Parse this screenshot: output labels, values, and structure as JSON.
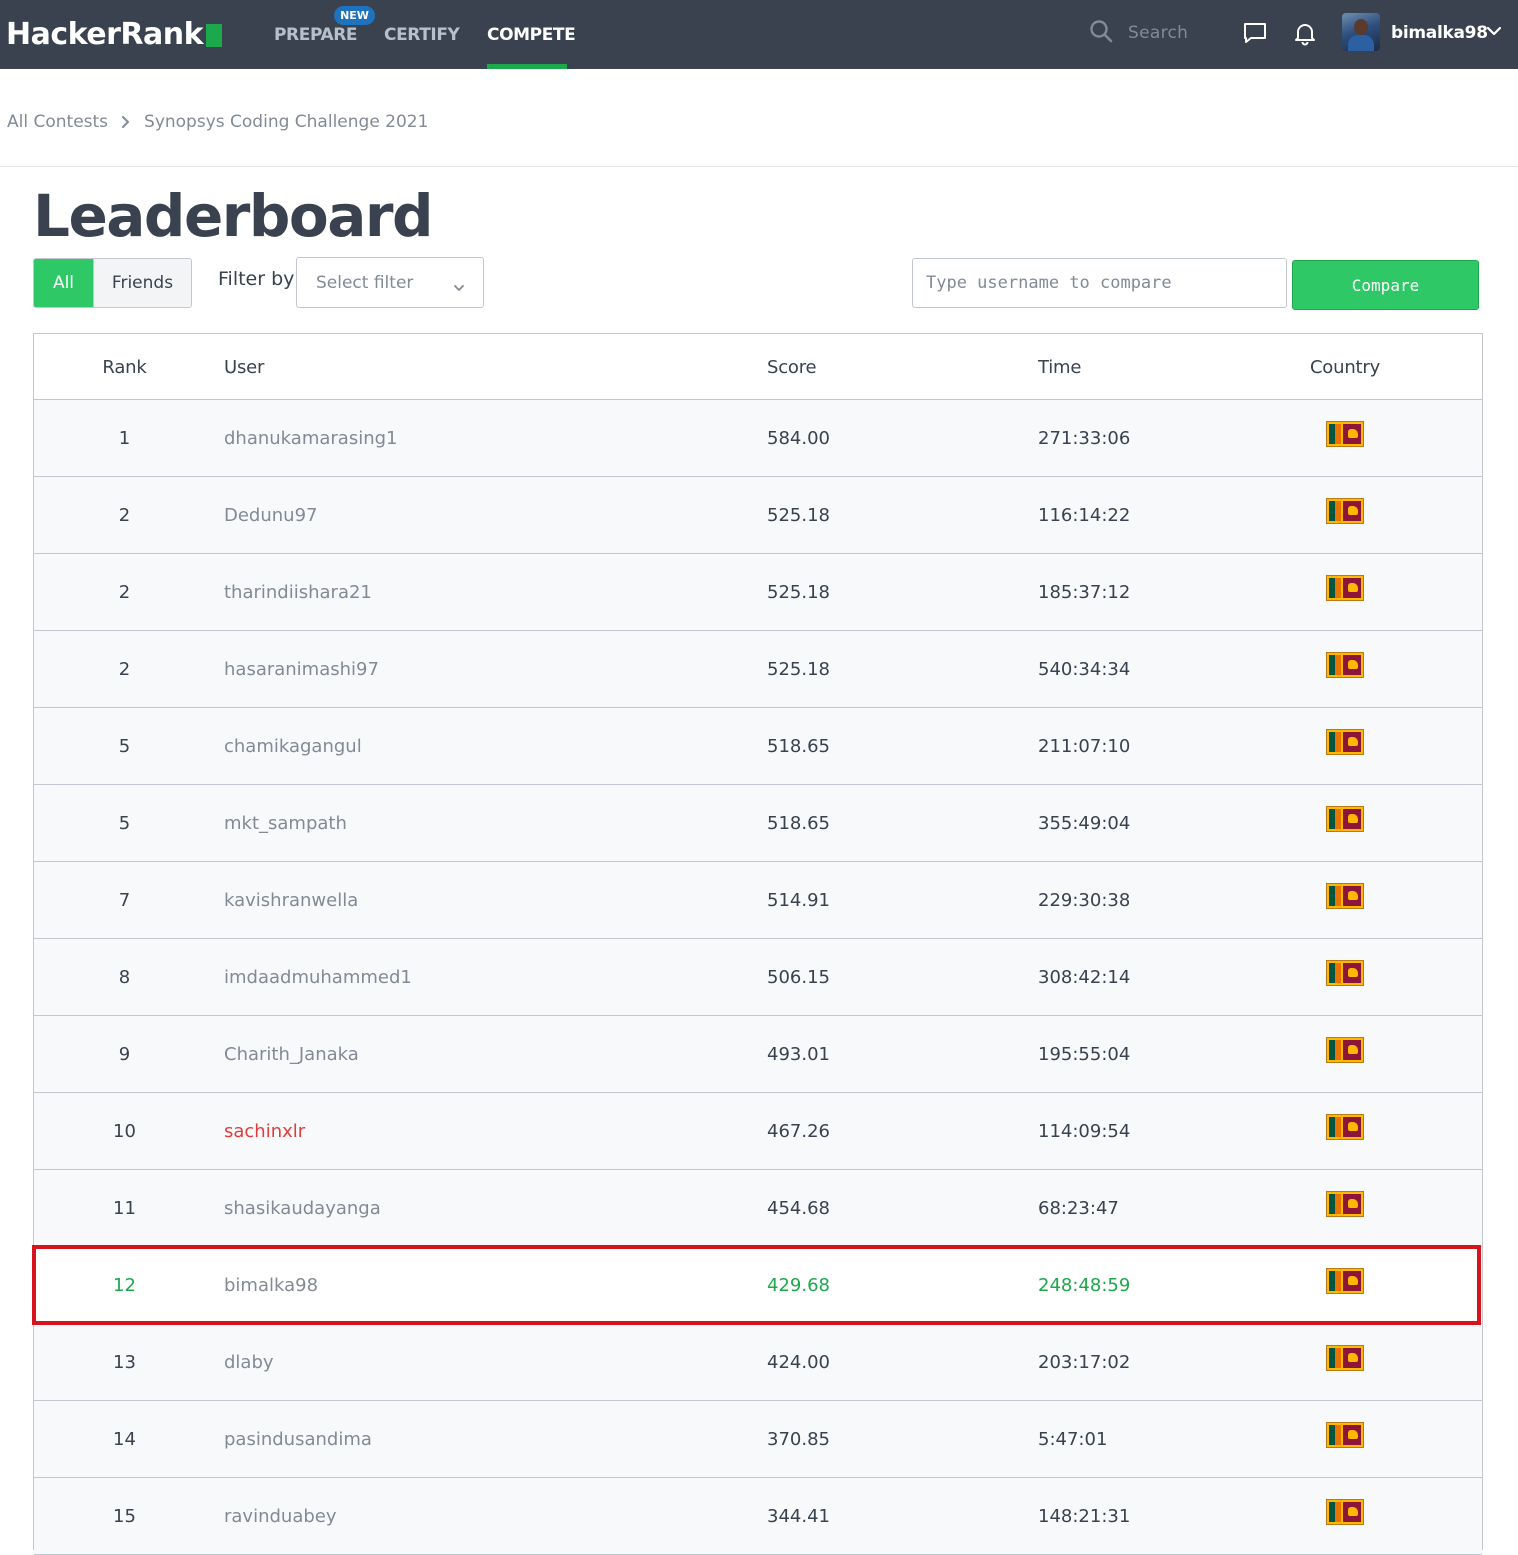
{
  "brand": {
    "logo_text": "HackerRank"
  },
  "nav": {
    "items": [
      {
        "label": "PREPARE",
        "badge": "NEW"
      },
      {
        "label": "CERTIFY"
      },
      {
        "label": "COMPETE",
        "active": true
      }
    ],
    "search_placeholder": "Search",
    "user": {
      "name": "bimalka98"
    }
  },
  "breadcrumb": [
    "All Contests",
    "Synopsys Coding Challenge 2021"
  ],
  "page": {
    "title": "Leaderboard",
    "toggle": {
      "all": "All",
      "friends": "Friends",
      "selected": "All"
    },
    "filter_label": "Filter by",
    "filter_placeholder": "Select filter",
    "compare_placeholder": "Type username to compare",
    "compare_button": "Compare"
  },
  "table": {
    "columns": [
      "Rank",
      "User",
      "Score",
      "Time",
      "Country"
    ],
    "rows": [
      {
        "rank": "1",
        "user": "dhanukamarasing1",
        "score": "584.00",
        "time": "271:33:06",
        "country_flag": "sri-lanka-flag"
      },
      {
        "rank": "2",
        "user": "Dedunu97",
        "score": "525.18",
        "time": "116:14:22",
        "country_flag": "sri-lanka-flag"
      },
      {
        "rank": "2",
        "user": "tharindiishara21",
        "score": "525.18",
        "time": "185:37:12",
        "country_flag": "sri-lanka-flag"
      },
      {
        "rank": "2",
        "user": "hasaranimashi97",
        "score": "525.18",
        "time": "540:34:34",
        "country_flag": "sri-lanka-flag"
      },
      {
        "rank": "5",
        "user": "chamikagangul",
        "score": "518.65",
        "time": "211:07:10",
        "country_flag": "sri-lanka-flag"
      },
      {
        "rank": "5",
        "user": "mkt_sampath",
        "score": "518.65",
        "time": "355:49:04",
        "country_flag": "sri-lanka-flag"
      },
      {
        "rank": "7",
        "user": "kavishranwella",
        "score": "514.91",
        "time": "229:30:38",
        "country_flag": "sri-lanka-flag"
      },
      {
        "rank": "8",
        "user": "imdaadmuhammed1",
        "score": "506.15",
        "time": "308:42:14",
        "country_flag": "sri-lanka-flag"
      },
      {
        "rank": "9",
        "user": "Charith_Janaka",
        "score": "493.01",
        "time": "195:55:04",
        "country_flag": "sri-lanka-flag"
      },
      {
        "rank": "10",
        "user": "sachinxlr",
        "score": "467.26",
        "time": "114:09:54",
        "country_flag": "sri-lanka-flag",
        "user_color": "#e33b3b"
      },
      {
        "rank": "11",
        "user": "shasikaudayanga",
        "score": "454.68",
        "time": "68:23:47",
        "country_flag": "sri-lanka-flag"
      },
      {
        "rank": "12",
        "user": "bimalka98",
        "score": "429.68",
        "time": "248:48:59",
        "country_flag": "sri-lanka-flag",
        "current_user": true
      },
      {
        "rank": "13",
        "user": "dlaby",
        "score": "424.00",
        "time": "203:17:02",
        "country_flag": "sri-lanka-flag"
      },
      {
        "rank": "14",
        "user": "pasindusandima",
        "score": "370.85",
        "time": "5:47:01",
        "country_flag": "sri-lanka-flag"
      },
      {
        "rank": "15",
        "user": "ravinduabey",
        "score": "344.41",
        "time": "148:21:31",
        "country_flag": "sri-lanka-flag"
      }
    ]
  },
  "colors": {
    "nav_bg": "#39424e",
    "accent_green": "#2ec866",
    "current_user_text": "#1ba94c",
    "highlight_box": "#d7141b",
    "new_badge": "#1e73be"
  }
}
